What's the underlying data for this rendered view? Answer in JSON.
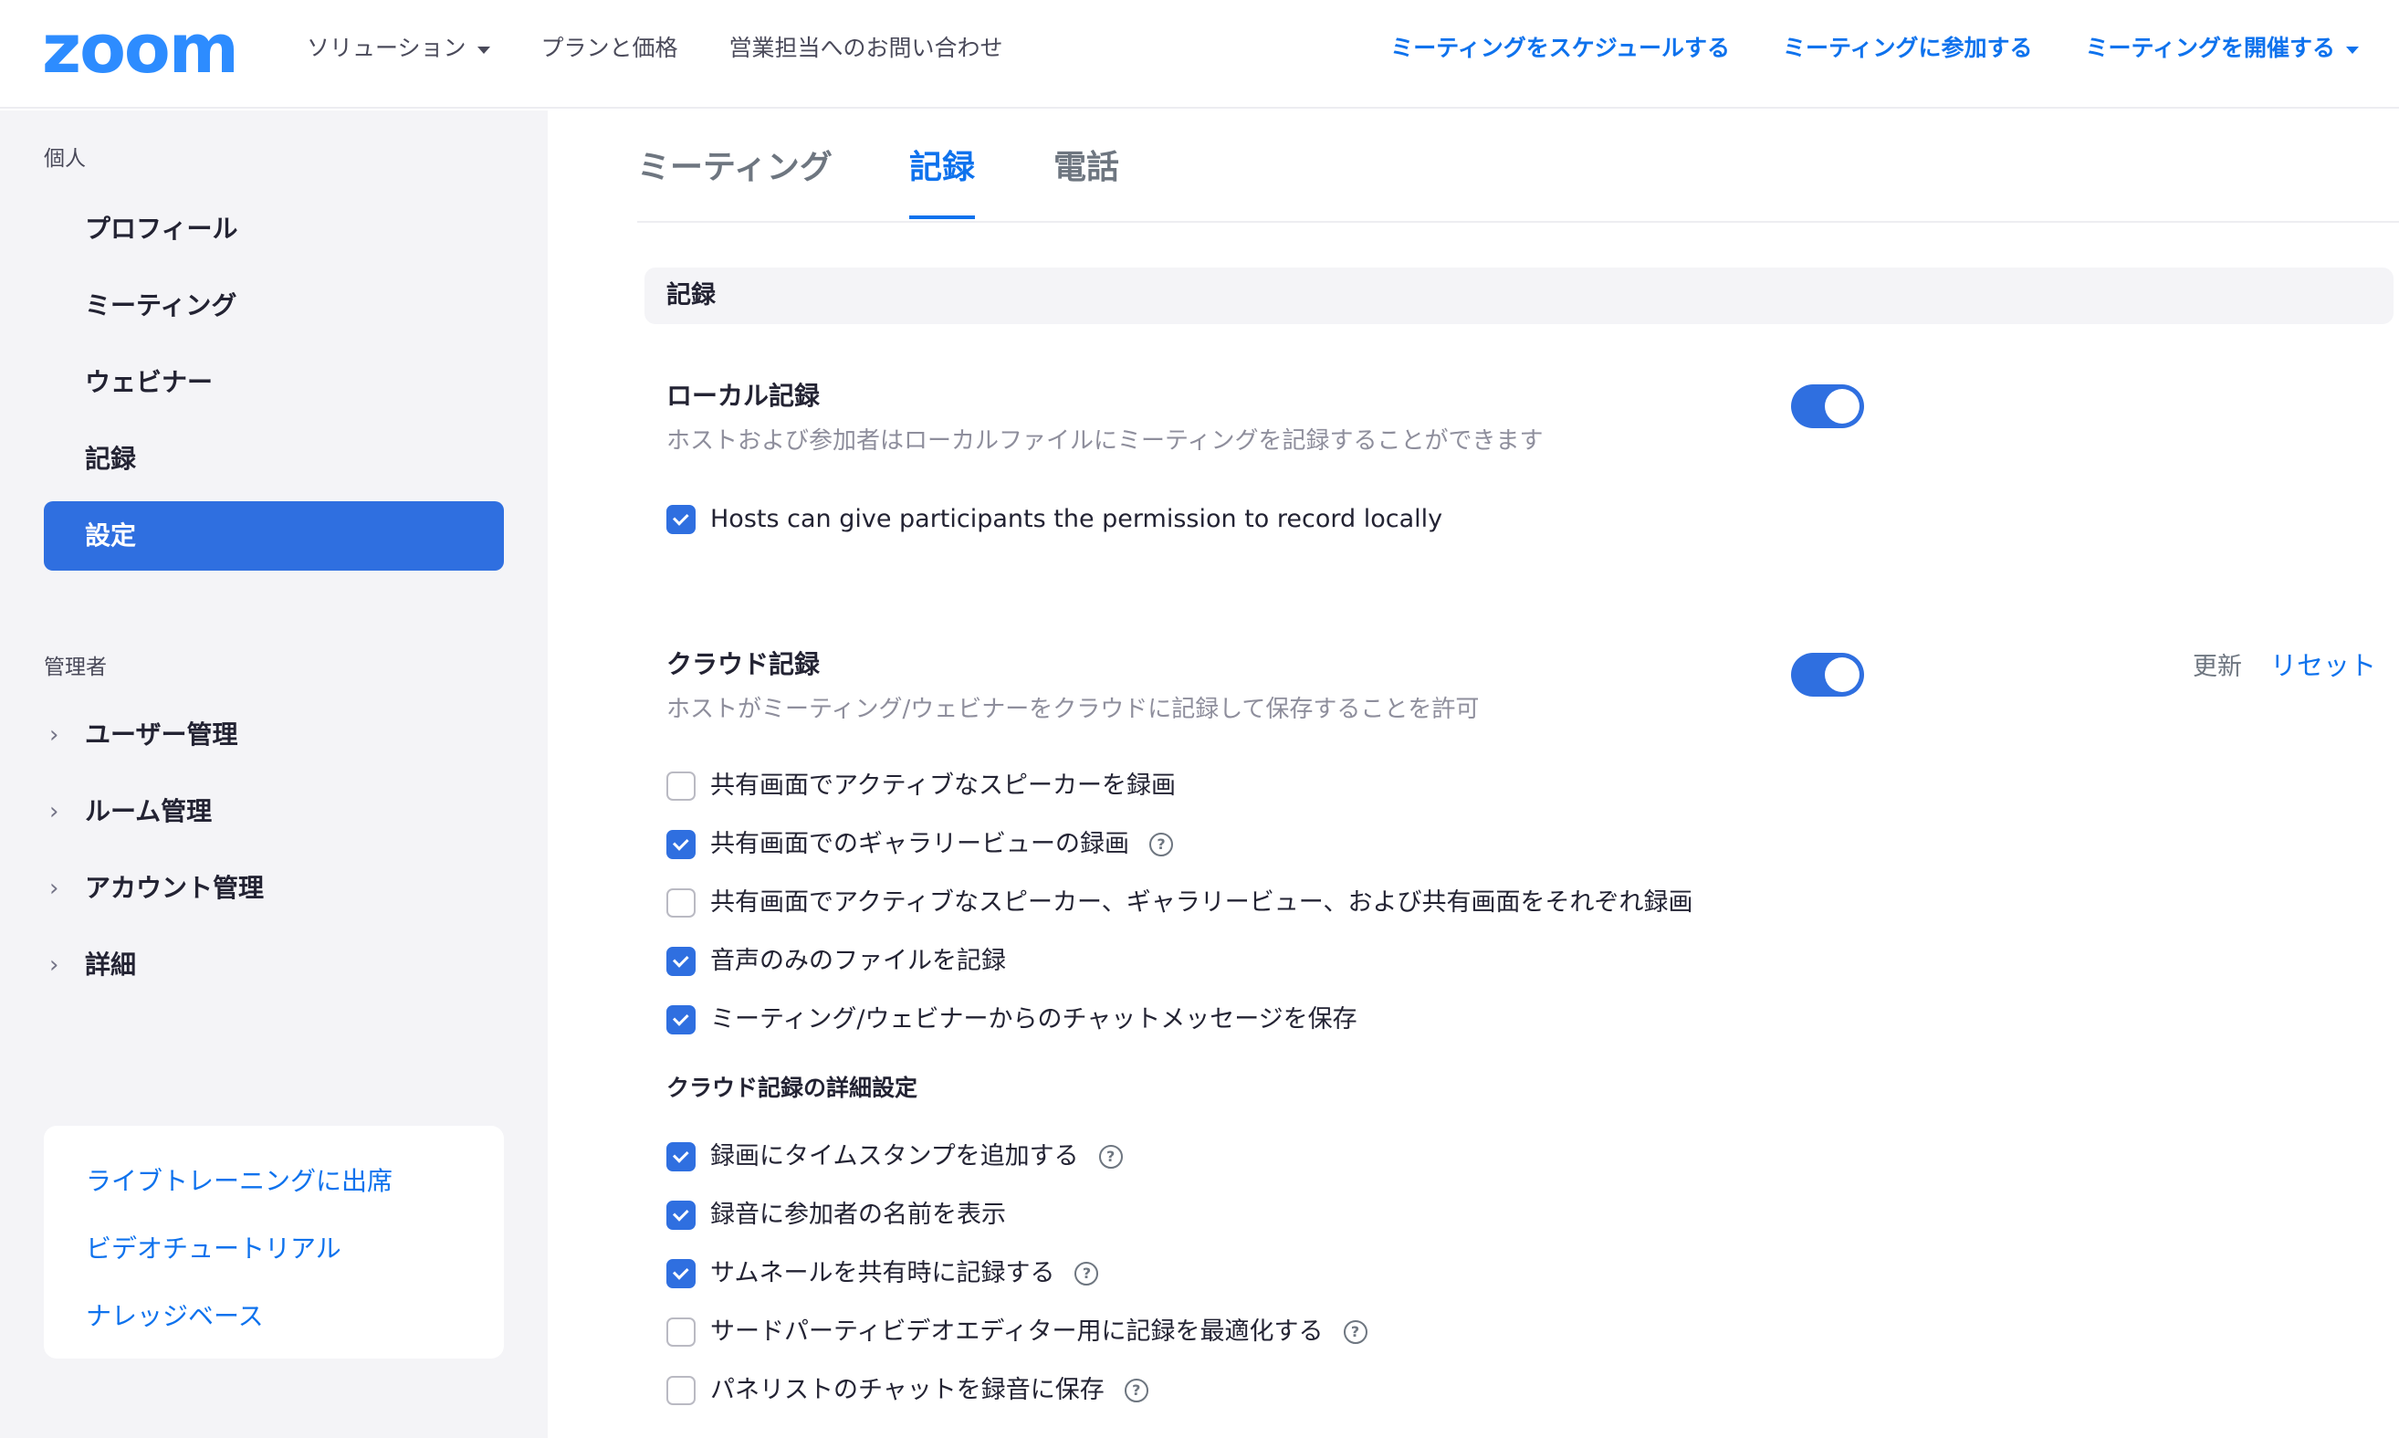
{
  "header": {
    "logo": "zoom",
    "nav_left": [
      {
        "label": "ソリューション",
        "has_caret": true
      },
      {
        "label": "プランと価格"
      },
      {
        "label": "営業担当へのお問い合わせ"
      }
    ],
    "nav_right": [
      {
        "label": "ミーティングをスケジュールする"
      },
      {
        "label": "ミーティングに参加する"
      },
      {
        "label": "ミーティングを開催する",
        "has_caret": true
      }
    ]
  },
  "sidebar": {
    "personal_label": "個人",
    "personal_items": [
      {
        "label": "プロフィール"
      },
      {
        "label": "ミーティング"
      },
      {
        "label": "ウェビナー"
      },
      {
        "label": "記録"
      },
      {
        "label": "設定",
        "active": true
      }
    ],
    "admin_label": "管理者",
    "admin_items": [
      {
        "label": "ユーザー管理"
      },
      {
        "label": "ルーム管理"
      },
      {
        "label": "アカウント管理"
      },
      {
        "label": "詳細"
      }
    ],
    "help_links": [
      {
        "label": "ライブトレーニングに出席"
      },
      {
        "label": "ビデオチュートリアル"
      },
      {
        "label": "ナレッジベース"
      }
    ]
  },
  "tabs": [
    {
      "label": "ミーティング"
    },
    {
      "label": "記録",
      "active": true
    },
    {
      "label": "電話"
    }
  ],
  "section_header": "記録",
  "local_recording": {
    "title": "ローカル記録",
    "description": "ホストおよび参加者はローカルファイルにミーティングを記録することができます",
    "enabled": true,
    "option": {
      "label": "Hosts can give participants the permission to record locally",
      "checked": true
    }
  },
  "cloud_recording": {
    "title": "クラウド記録",
    "description": "ホストがミーティング/ウェビナーをクラウドに記録して保存することを許可",
    "enabled": true,
    "update_label": "更新",
    "reset_label": "リセット",
    "options": [
      {
        "label": "共有画面でアクティブなスピーカーを録画",
        "checked": false,
        "help": false
      },
      {
        "label": "共有画面でのギャラリービューの録画",
        "checked": true,
        "help": true
      },
      {
        "label": "共有画面でアクティブなスピーカー、ギャラリービュー、および共有画面をそれぞれ録画",
        "checked": false,
        "help": false
      },
      {
        "label": "音声のみのファイルを記録",
        "checked": true,
        "help": false
      },
      {
        "label": "ミーティング/ウェビナーからのチャットメッセージを保存",
        "checked": true,
        "help": false
      }
    ],
    "advanced_title": "クラウド記録の詳細設定",
    "advanced_options": [
      {
        "label": "録画にタイムスタンプを追加する",
        "checked": true,
        "help": true
      },
      {
        "label": "録音に参加者の名前を表示",
        "checked": true,
        "help": false
      },
      {
        "label": "サムネールを共有時に記録する",
        "checked": true,
        "help": true
      },
      {
        "label": "サードパーティビデオエディター用に記録を最適化する",
        "checked": false,
        "help": true
      },
      {
        "label": "パネリストのチャットを録音に保存",
        "checked": false,
        "help": true
      }
    ]
  },
  "help_icon_glyph": "?",
  "colors": {
    "accent": "#2f6fe0",
    "link": "#0e72ed",
    "logo": "#2d8cff"
  }
}
